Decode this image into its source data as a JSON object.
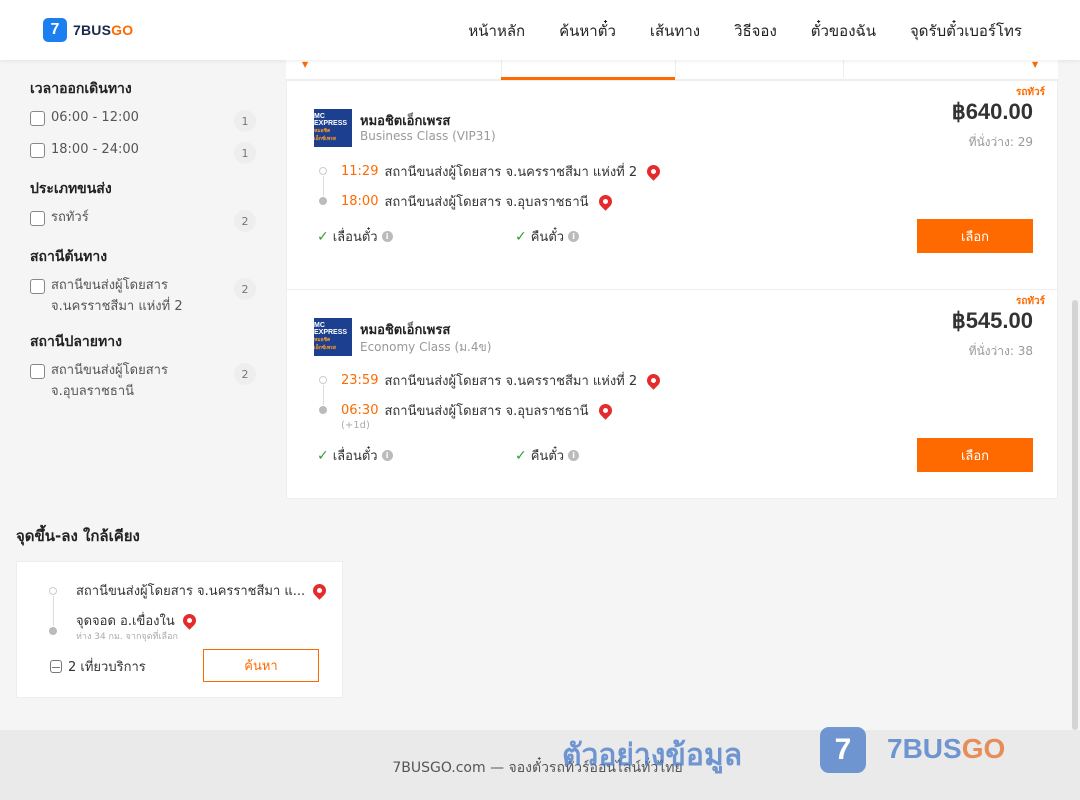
{
  "header": {
    "logo_mark": "7",
    "logo_text": "7BUS",
    "logo_text_accent": "GO",
    "nav": [
      "หน้าหลัก",
      "ค้นหาตั๋ว",
      "เส้นทาง",
      "วิธีจอง",
      "ตั๋วของฉัน",
      "จุดรับตั๋วเบอร์โทร"
    ]
  },
  "filters": {
    "departure_time": {
      "title": "เวลาออกเดินทาง",
      "options": [
        {
          "label": "06:00 - 12:00",
          "count": "1"
        },
        {
          "label": "18:00 - 24:00",
          "count": "1"
        }
      ]
    },
    "vehicle_type": {
      "title": "ประเภทขนส่ง",
      "options": [
        {
          "label": "รถทัวร์",
          "count": "2"
        }
      ]
    },
    "origin_station": {
      "title": "สถานีต้นทาง",
      "options": [
        {
          "label": "สถานีขนส่งผู้โดยสาร จ.นครราชสีมา แห่งที่ 2",
          "count": "2"
        }
      ]
    },
    "destination_station": {
      "title": "สถานีปลายทาง",
      "options": [
        {
          "label": "สถานีขนส่งผู้โดยสาร จ.อุบลราชธานี",
          "count": "2"
        }
      ]
    }
  },
  "trips": [
    {
      "tag": "รถทัวร์",
      "operator_logo_line1": "MC EXPRESS",
      "operator_logo_line2": "หมอชิต เอ็กซ์เพรส",
      "operator": "หมอชิตเอ็กเพรส",
      "class": "Business Class (VIP31)",
      "price": "฿640.00",
      "seats": "ที่นั่งว่าง: 29",
      "depart_time": "11:29",
      "depart_station": "สถานีขนส่งผู้โดยสาร จ.นครราชสีมา แห่งที่ 2",
      "arrive_time": "18:00",
      "arrive_station": "สถานีขนส่งผู้โดยสาร จ.อุบลราชธานี",
      "next_day": "",
      "feature1": "เลื่อนตั๋ว",
      "feature2": "คืนตั๋ว",
      "button": "เลือก"
    },
    {
      "tag": "รถทัวร์",
      "operator_logo_line1": "MC EXPRESS",
      "operator_logo_line2": "หมอชิต เอ็กซ์เพรส",
      "operator": "หมอชิตเอ็กเพรส",
      "class": "Economy Class (ม.4ข)",
      "price": "฿545.00",
      "seats": "ที่นั่งว่าง: 38",
      "depart_time": "23:59",
      "depart_station": "สถานีขนส่งผู้โดยสาร จ.นครราชสีมา แห่งที่ 2",
      "arrive_time": "06:30",
      "arrive_station": "สถานีขนส่งผู้โดยสาร จ.อุบลราชธานี",
      "next_day": "(+1d)",
      "feature1": "เลื่อนตั๋ว",
      "feature2": "คืนตั๋ว",
      "button": "เลือก"
    }
  ],
  "nearby": {
    "title": "จุดขึ้น-ลง ใกล้เคียง",
    "from": "สถานีขนส่งผู้โดยสาร จ.นครราชสีมา แ...",
    "to": "จุดจอด อ.เขื่องใน",
    "distance": "ห่าง 34 กม. จากจุดที่เลือก",
    "trips": "2 เที่ยวบริการ",
    "button": "ค้นหา"
  },
  "footer": {
    "text": "7BUSGO.com — จองตั๋วรถทัวร์ออนไลน์ทั่วไทย"
  },
  "watermark": {
    "text": "ตัวอย่างข้อมูล",
    "logo_mark": "7",
    "brand": "7BUS",
    "brand_accent": "GO"
  },
  "colors": {
    "accent": "#ff6a00",
    "brand_blue": "#1b7ff2",
    "pin_red": "#e52b2b",
    "check_green": "#2e9e2e"
  }
}
